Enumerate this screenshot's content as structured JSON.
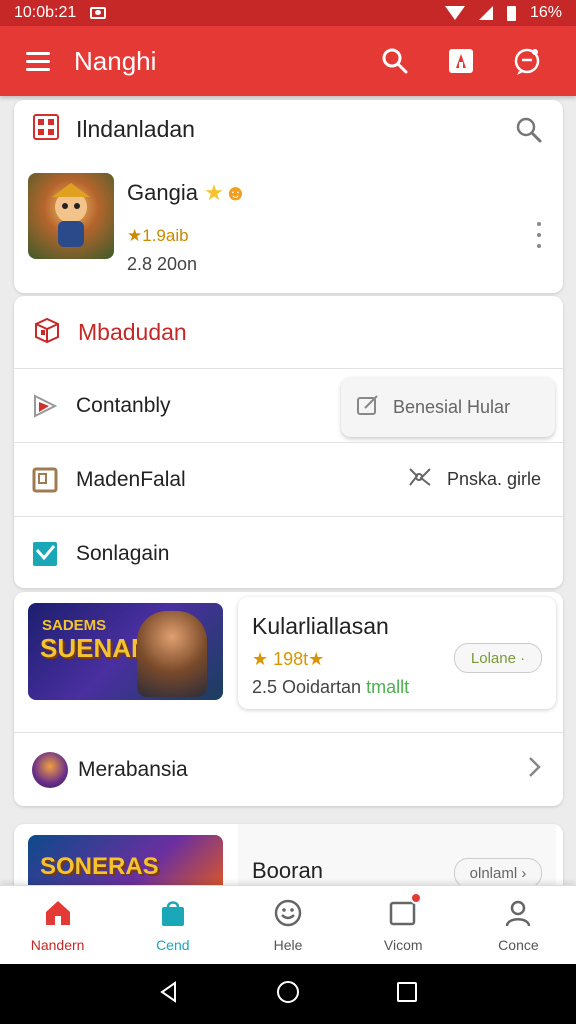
{
  "status": {
    "time": "10:0b:21",
    "battery": "16%"
  },
  "appbar": {
    "title": "Nanghi",
    "icons": [
      "menu-icon",
      "search-icon",
      "store-icon",
      "chat-icon"
    ]
  },
  "card1": {
    "title": "Ilndanladan",
    "game": {
      "name": "Gangia",
      "rating": "★1.9aib",
      "size": "2.8 20on"
    }
  },
  "card2": {
    "title": "Mbadudan",
    "rows": [
      {
        "label": "Contanbly",
        "chip": "Benesial Hular"
      },
      {
        "label": "MadenFalal",
        "side": "Pnska. girle"
      },
      {
        "label": "Sonlagain"
      }
    ]
  },
  "card3": {
    "banner_text": "SUENANS",
    "banner_top": "SADEMS",
    "title": "Kularliallasan",
    "rating": "★ 198t★",
    "meta": "2.5 Ooidartan",
    "meta_highlight": "tmallt",
    "pill": "Lolane ·",
    "row_label": "Merabansia"
  },
  "card4": {
    "banner_text": "SONERAS",
    "title": "Booran",
    "pill": "olnlaml ›"
  },
  "bottomnav": [
    {
      "label": "Nandern",
      "icon": "home-icon"
    },
    {
      "label": "Cend",
      "icon": "shopping-bag-icon"
    },
    {
      "label": "Hele",
      "icon": "smile-icon"
    },
    {
      "label": "Vicom",
      "icon": "square-icon"
    },
    {
      "label": "Conce",
      "icon": "person-icon"
    }
  ],
  "colors": {
    "primary": "#e53935",
    "status": "#c62828",
    "accent_teal": "#1aa7b8"
  }
}
